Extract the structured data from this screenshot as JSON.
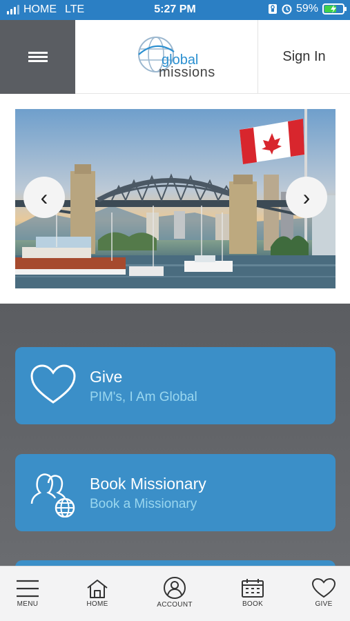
{
  "status_bar": {
    "carrier": "HOME",
    "network": "LTE",
    "time": "5:27 PM",
    "battery": "59%",
    "battery_level": 0.59
  },
  "header": {
    "logo_line1": "global",
    "logo_line2": "missions",
    "sign_in_label": "Sign In",
    "menu_icon": "hamburger-icon"
  },
  "carousel": {
    "prev_arrow": "‹",
    "next_arrow": "›"
  },
  "cards": [
    {
      "title": "Give",
      "subtitle": "PIM's, I Am Global",
      "icon": "heart-icon"
    },
    {
      "title": "Book Missionary",
      "subtitle": "Book a Missionary",
      "icon": "missionary-globe-icon"
    }
  ],
  "bottom_nav": [
    {
      "label": "MENU",
      "icon": "menu-icon"
    },
    {
      "label": "HOME",
      "icon": "home-icon"
    },
    {
      "label": "ACCOUNT",
      "icon": "account-icon"
    },
    {
      "label": "BOOK",
      "icon": "calendar-icon"
    },
    {
      "label": "GIVE",
      "icon": "heart-icon"
    }
  ],
  "colors": {
    "status_bar": "#2b7fc4",
    "card_bg": "#3b8fc8",
    "card_subtitle": "#9ad7ef",
    "menu_button_bg": "#5a5d62",
    "dark_background": "#5b5d61"
  }
}
